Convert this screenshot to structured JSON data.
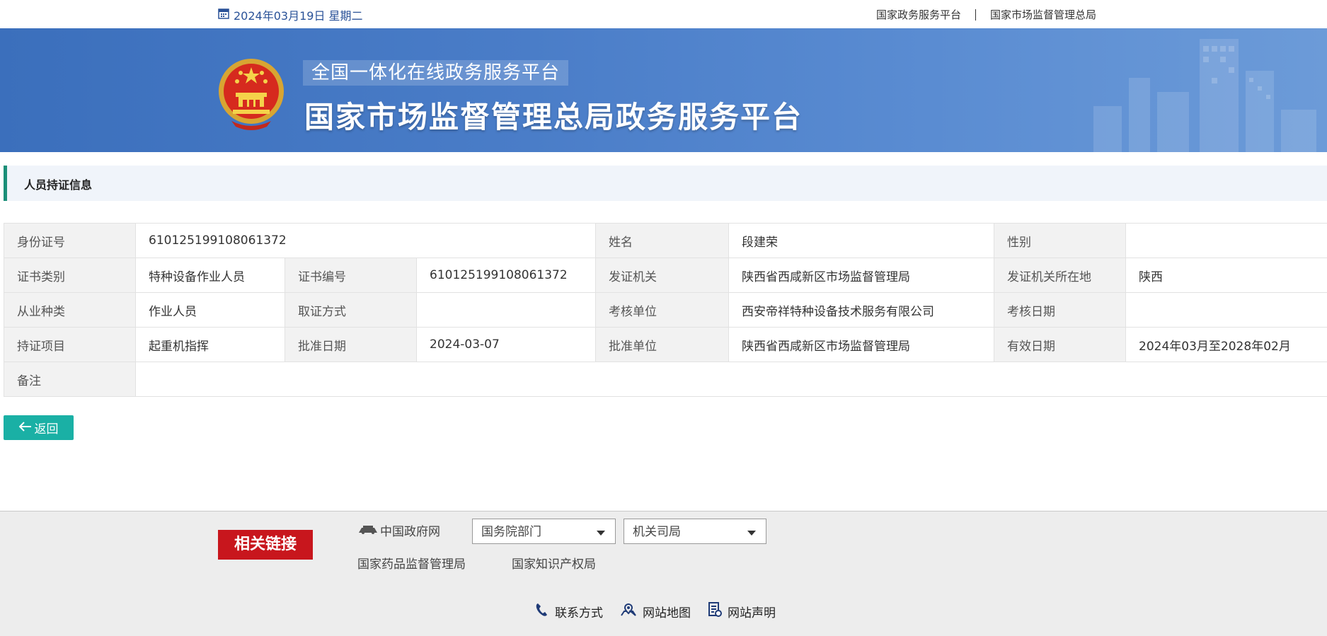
{
  "topbar": {
    "date": "2024年03月19日 星期二",
    "links": [
      "国家政务服务平台",
      "国家市场监督管理总局"
    ]
  },
  "banner": {
    "subtitle": "全国一体化在线政务服务平台",
    "title": "国家市场监督管理总局政务服务平台"
  },
  "section": {
    "title": "人员持证信息"
  },
  "table": {
    "id_label": "身份证号",
    "id_value": "610125199108061372",
    "name_label": "姓名",
    "name_value": "段建荣",
    "gender_label": "性别",
    "gender_value": "",
    "cert_type_label": "证书类别",
    "cert_type_value": "特种设备作业人员",
    "cert_no_label": "证书编号",
    "cert_no_value": "610125199108061372",
    "issuer_label": "发证机关",
    "issuer_value": "陕西省西咸新区市场监督管理局",
    "issuer_loc_label": "发证机关所在地",
    "issuer_loc_value": "陕西",
    "occupation_label": "从业种类",
    "occupation_value": "作业人员",
    "obtain_label": "取证方式",
    "obtain_value": "",
    "exam_unit_label": "考核单位",
    "exam_unit_value": "西安帝祥特种设备技术服务有限公司",
    "exam_date_label": "考核日期",
    "exam_date_value": "",
    "item_label": "持证项目",
    "item_value": "起重机指挥",
    "approve_date_label": "批准日期",
    "approve_date_value": "2024-03-07",
    "approve_unit_label": "批准单位",
    "approve_unit_value": "陕西省西咸新区市场监督管理局",
    "valid_label": "有效日期",
    "valid_value": "2024年03月至2028年02月",
    "remark_label": "备注",
    "remark_value": ""
  },
  "back_button": {
    "label": "返回"
  },
  "related": {
    "badge": "相关链接",
    "gov_link": "中国政府网",
    "select1": "国务院部门",
    "select2": "机关司局",
    "links": [
      "国家药品监督管理局",
      "国家知识产权局"
    ]
  },
  "footer": {
    "links": [
      "联系方式",
      "网站地图",
      "网站声明"
    ]
  },
  "colors": {
    "banner_blue": "#4a7dc8",
    "accent_green": "#1b8f78",
    "button_teal": "#1ab0a5",
    "badge_red": "#c8161d"
  }
}
